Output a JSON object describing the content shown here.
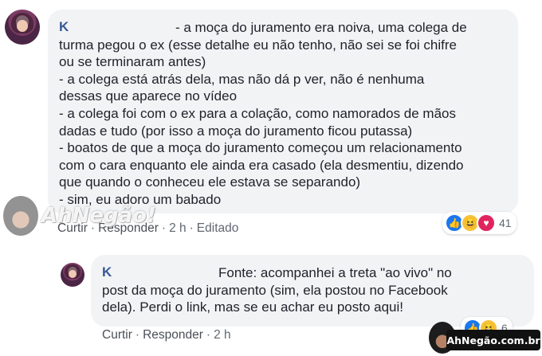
{
  "comments": [
    {
      "author": "K",
      "text": "- a moça do juramento era noiva, uma colega de\nturma pegou o ex (esse detalhe eu não tenho, não sei se foi chifre\nou se terminaram antes)\n- a colega está atrás dela, mas não dá p ver, não é nenhuma\ndessas que aparece no vídeo\n- a colega foi com o ex para a colação, como namorados de mãos\ndadas e tudo (por isso a moça do juramento ficou putassa)\n- boatos de que a moça do juramento começou um relacionamento\ncom o cara enquanto ele ainda era casado (ela desmentiu, dizendo\nque quando o conheceu ele estava se separando)\n- sim, eu adoro um babado",
      "actions": {
        "like": "Curtir",
        "reply": "Responder",
        "time": "2 h",
        "edited": "Editado"
      },
      "reactions": {
        "icons": [
          "like-icon",
          "haha-icon",
          "love-icon"
        ],
        "count": "41"
      }
    },
    {
      "author": "K",
      "text": "Fonte: acompanhei a treta \"ao vivo\" no\npost da moça do juramento (sim, ela postou no Facebook\ndela). Perdi o link, mas se eu achar eu posto aqui!",
      "actions": {
        "like": "Curtir",
        "reply": "Responder",
        "time": "2 h"
      },
      "reactions": {
        "icons": [
          "like-icon",
          "haha-icon"
        ],
        "count": "6"
      }
    }
  ],
  "watermarks": {
    "left": "AhNegão!",
    "brand": "AhNegão.com.br"
  },
  "colors": {
    "bubble": "#f2f3f5",
    "author": "#385898",
    "meta": "#606770"
  }
}
